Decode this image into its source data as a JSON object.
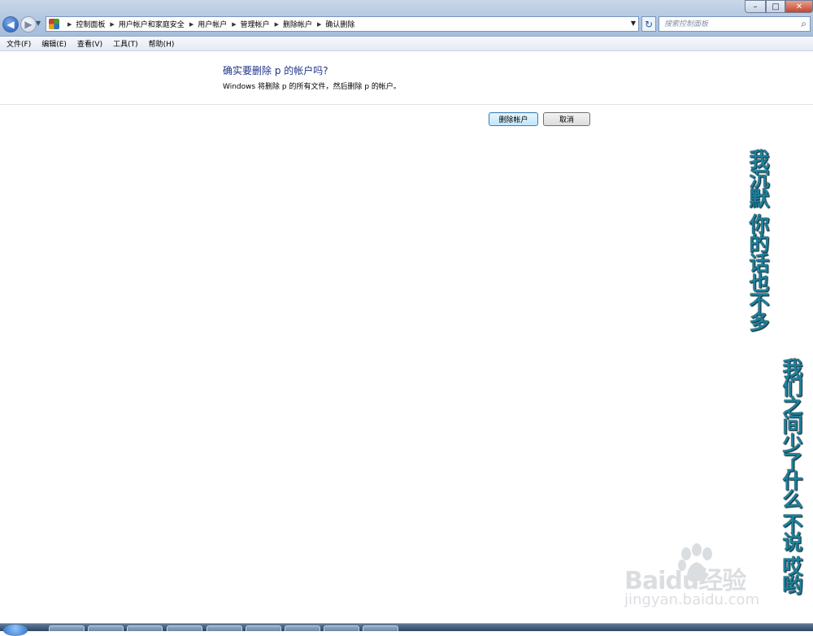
{
  "window": {
    "controls": {
      "minimize": "–",
      "maximize": "□",
      "close": "✕"
    }
  },
  "address_bar": {
    "breadcrumbs": [
      "控制面板",
      "用户帐户和家庭安全",
      "用户帐户",
      "管理帐户",
      "删除帐户",
      "确认删除"
    ],
    "search_placeholder": "搜索控制面板"
  },
  "menu": {
    "items": [
      "文件(F)",
      "编辑(E)",
      "查看(V)",
      "工具(T)",
      "帮助(H)"
    ]
  },
  "dialog": {
    "question": "确实要删除 p 的帐户吗?",
    "description": "Windows 将删除 p 的所有文件，然后删除 p 的帐户。",
    "delete_button": "删除帐户",
    "cancel_button": "取消"
  },
  "overlay": {
    "lyric_line_1": "我沉默 你的话也不多",
    "lyric_line_2": "我们之间少了什么 不说 哎哟",
    "lyric_color": "#1c7f9a"
  },
  "watermark": {
    "logo_text": "Baidu经验",
    "url": "jingyan.baidu.com"
  },
  "icons": {
    "back": "back-arrow-icon",
    "forward": "forward-arrow-icon",
    "control_panel": "control-panel-icon",
    "refresh": "refresh-icon",
    "search": "search-icon"
  }
}
